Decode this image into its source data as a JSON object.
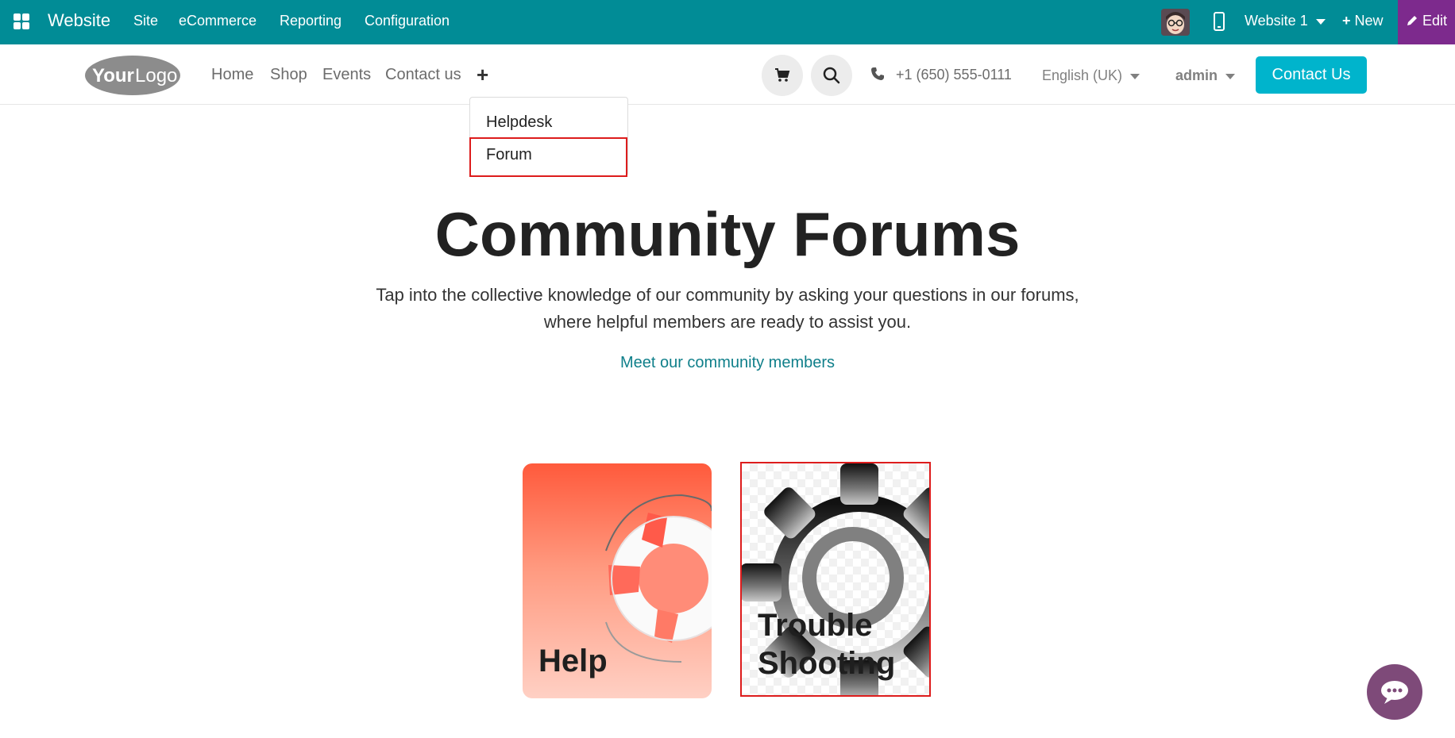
{
  "topbar": {
    "brand": "Website",
    "menu": [
      "Site",
      "eCommerce",
      "Reporting",
      "Configuration"
    ],
    "website_selector": "Website 1",
    "new_label": "New",
    "edit_label": "Edit"
  },
  "navbar": {
    "logo_text": "YourLogo",
    "links": [
      "Home",
      "Shop",
      "Events",
      "Contact us"
    ],
    "plus": "+",
    "phone": "+1 (650) 555-0111",
    "language": "English (UK)",
    "user": "admin",
    "contact_button": "Contact Us"
  },
  "dropdown": {
    "items": [
      "Helpdesk",
      "Forum"
    ],
    "highlighted": "Forum"
  },
  "hero": {
    "title": "Community Forums",
    "description_line1": "Tap into the collective knowledge of our community by asking your questions in our forums,",
    "description_line2": "where helpful members are ready to assist you.",
    "link": "Meet our community members"
  },
  "cards": [
    {
      "label": "Help"
    },
    {
      "label_line1": "Trouble",
      "label_line2": "Shooting"
    }
  ],
  "colors": {
    "topbar": "#018c96",
    "edit": "#7d2a8d",
    "contact_button": "#00b4cc",
    "highlight": "#dd1c1c",
    "chat": "#7e4a79"
  }
}
